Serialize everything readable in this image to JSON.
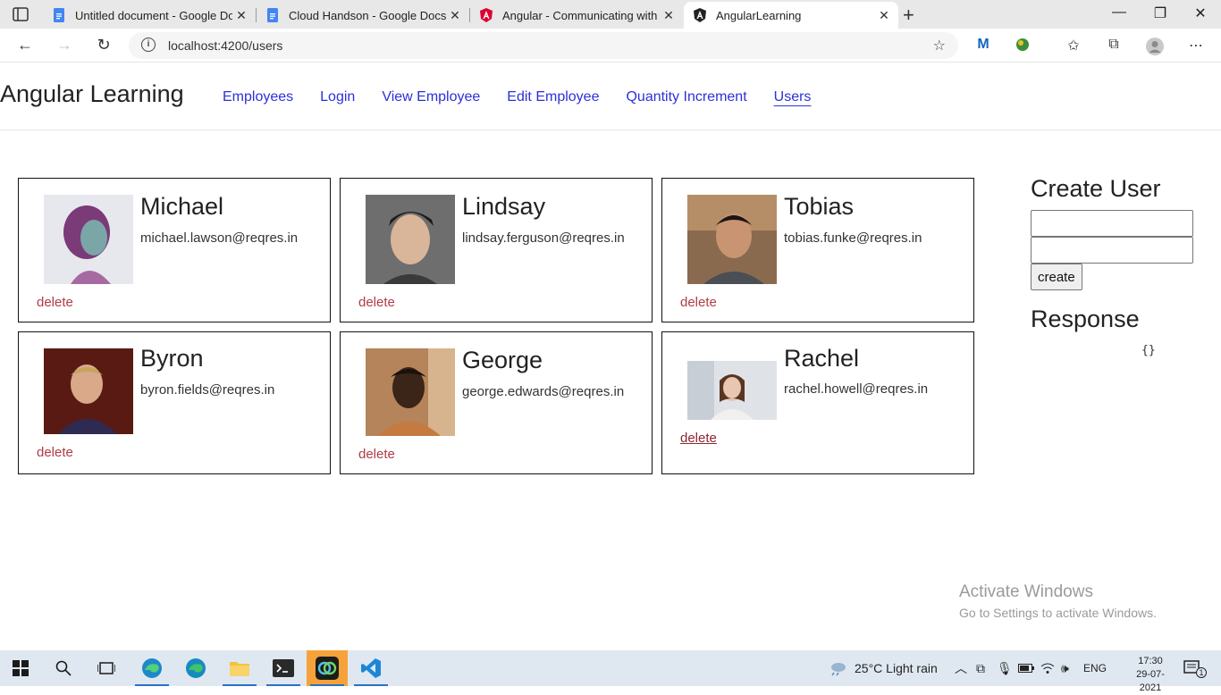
{
  "browser": {
    "tabs": [
      {
        "title": "Untitled document - Google Doc",
        "icon": "google-docs-icon"
      },
      {
        "title": "Cloud Handson - Google Docs",
        "icon": "google-docs-icon"
      },
      {
        "title": "Angular - Communicating with b",
        "icon": "angular-icon"
      },
      {
        "title": "AngularLearning",
        "icon": "angular-icon",
        "active": true
      }
    ],
    "url": "localhost:4200/users"
  },
  "app": {
    "brand": "Angular Learning",
    "nav": [
      "Employees",
      "Login",
      "View Employee",
      "Edit Employee",
      "Quantity Increment",
      "Users"
    ],
    "active_nav": "Users",
    "users": [
      {
        "name": "Michael",
        "email": "michael.lawson@reqres.in",
        "delete": "delete"
      },
      {
        "name": "Lindsay",
        "email": "lindsay.ferguson@reqres.in",
        "delete": "delete"
      },
      {
        "name": "Tobias",
        "email": "tobias.funke@reqres.in",
        "delete": "delete"
      },
      {
        "name": "Byron",
        "email": "byron.fields@reqres.in",
        "delete": "delete"
      },
      {
        "name": "George",
        "email": "george.edwards@reqres.in",
        "delete": "delete"
      },
      {
        "name": "Rachel",
        "email": "rachel.howell@reqres.in",
        "delete": "delete"
      }
    ],
    "create_user": {
      "title": "Create User",
      "field1_value": "",
      "field2_value": "",
      "button": "create"
    },
    "response": {
      "title": "Response",
      "body": "{}"
    }
  },
  "watermark": {
    "line1": "Activate Windows",
    "line2": "Go to Settings to activate Windows."
  },
  "taskbar": {
    "weather": "25°C  Light rain",
    "lang": "ENG",
    "time": "17:30",
    "date": "29-07-2021",
    "notification_count": "1"
  },
  "colors": {
    "link": "#2c30d8",
    "delete": "#b13b45",
    "taskbar": "#dfe8f1"
  }
}
